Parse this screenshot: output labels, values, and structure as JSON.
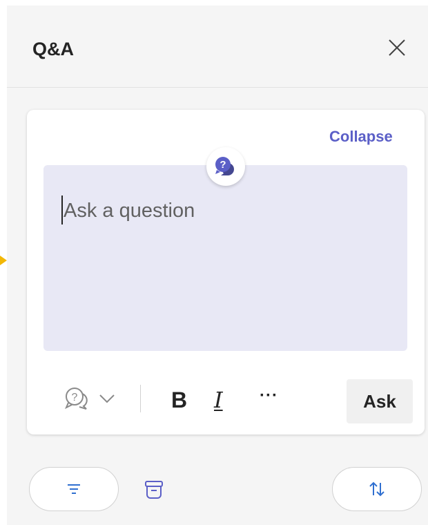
{
  "header": {
    "title": "Q&A",
    "close_icon": "close-icon"
  },
  "composer": {
    "collapse_label": "Collapse",
    "badge_icon": "qa-chat-icon",
    "placeholder": "Ask a question",
    "toolbar": {
      "question_type_icon": "question-chat-icon",
      "dropdown_icon": "chevron-down-icon",
      "bold_label": "B",
      "italic_label": "I",
      "more_label": "···",
      "ask_label": "Ask"
    }
  },
  "footer": {
    "filter_icon": "filter-icon",
    "archive_icon": "archive-icon",
    "sort_icon": "sort-icon"
  },
  "colors": {
    "accent": "#5b5fc7",
    "panel_bg": "#f5f5f5",
    "input_bg": "#e8e8f5",
    "pointer": "#f2b705"
  }
}
